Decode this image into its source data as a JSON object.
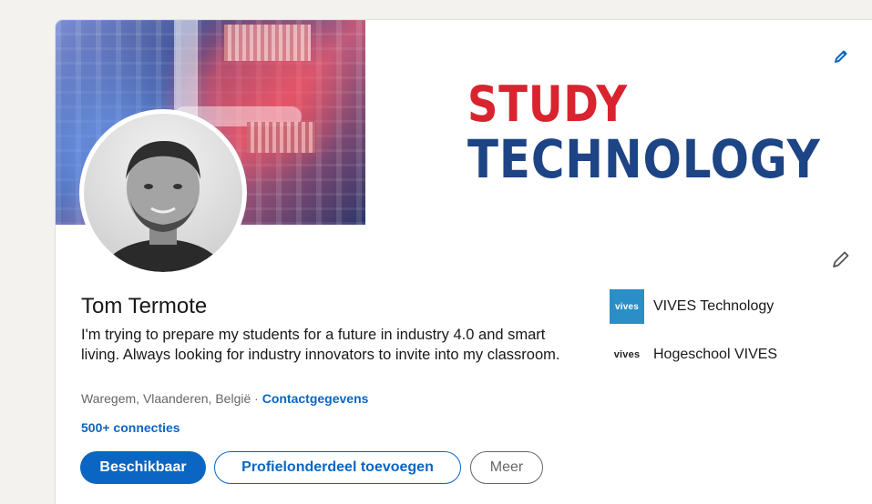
{
  "banner": {
    "title_line1": "STUDY",
    "title_line2": "TECHNOLOGY",
    "edit_icon": "pencil-icon"
  },
  "profile": {
    "name": "Tom Termote",
    "headline": "I'm trying to prepare my students for a future in industry 4.0 and smart living. Always looking for industry innovators to invite into my classroom.",
    "location": "Waregem, Vlaanderen, België",
    "separator": " · ",
    "contact_link": "Contactgegevens",
    "connections": "500+ connecties"
  },
  "actions": {
    "primary": "Beschikbaar",
    "secondary": "Profielonderdeel toevoegen",
    "tertiary": "Meer"
  },
  "organizations": [
    {
      "logo_text": "vives",
      "name": "VIVES Technology"
    },
    {
      "logo_text": "vives",
      "name": "Hogeschool VIVES"
    }
  ],
  "colors": {
    "accent": "#0a66c2",
    "banner_red": "#d9232e",
    "banner_blue": "#1d4484",
    "vives_blue": "#2a8fc6"
  }
}
